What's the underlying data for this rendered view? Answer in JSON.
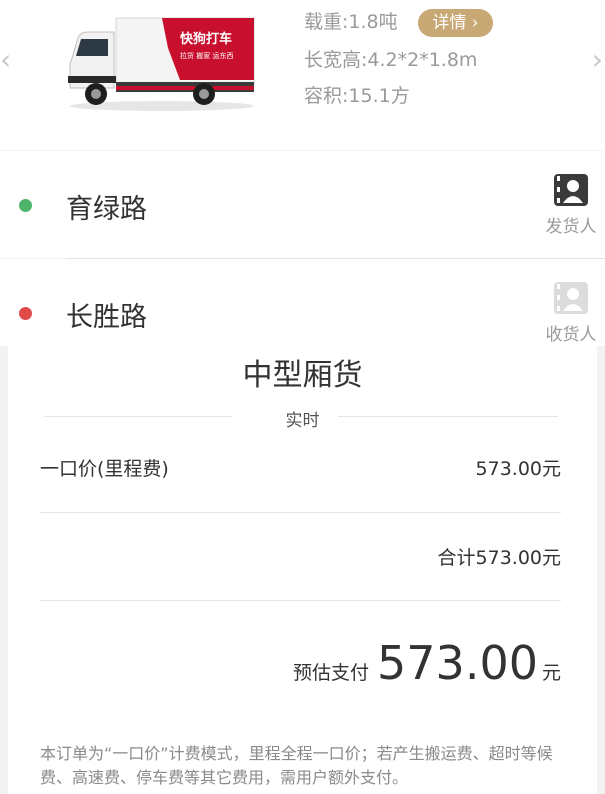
{
  "vehicle": {
    "brand_text": "快狗打车",
    "brand_sub": "拉货 搬家 运东西",
    "load": "载重:1.8吨",
    "size": "长宽高:4.2*2*1.8m",
    "volume": "容积:15.1方",
    "detail_label": "详情",
    "detail_icon": "chevron-right",
    "prev_icon": "chevron-left",
    "next_icon": "chevron-right"
  },
  "route": {
    "from": {
      "name": "育绿路",
      "contact_label": "发货人",
      "dot_color": "#4db56a"
    },
    "to": {
      "name": "长胜路",
      "contact_label": "收货人",
      "dot_color": "#e24a4a"
    }
  },
  "order": {
    "vehicle_type": "中型厢货",
    "mode": "实时",
    "fee_label": "一口价(里程费)",
    "fee_value": "573.00元",
    "total": "合计573.00元",
    "estimate_label": "预估支付",
    "estimate_value": "573.00",
    "estimate_unit": "元",
    "note": "本订单为“一口价”计费模式，里程全程一口价；若产生搬运费、超时等候费、高速费、停车费等其它费用，需用户额外支付。"
  },
  "colors": {
    "accent": "#c8a874",
    "truck_red": "#c8102e"
  }
}
